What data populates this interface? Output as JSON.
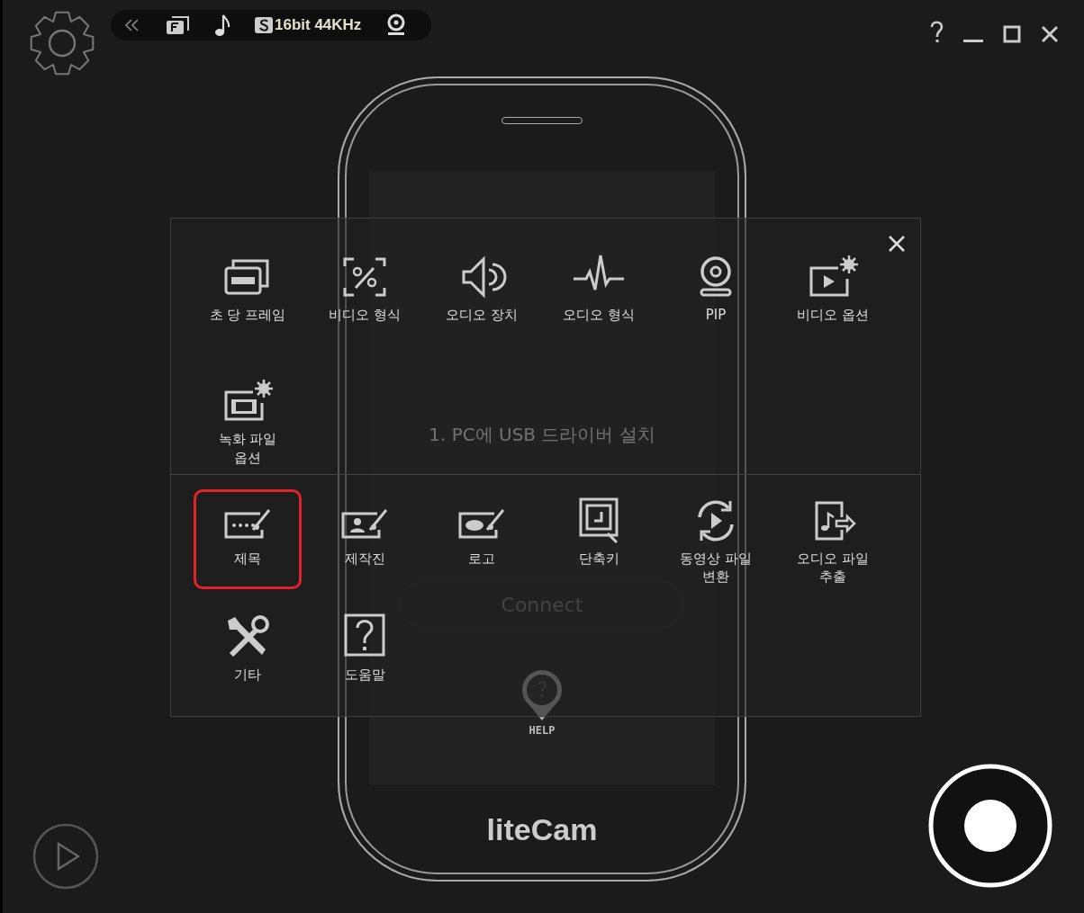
{
  "toolbar": {
    "audio_format": "16bit 44KHz"
  },
  "phone": {
    "step": "1. PC에 USB 드라이버 설치",
    "connect_button": "Connect",
    "help_label": "HELP",
    "logo": "liteCam"
  },
  "menu": {
    "sections": [
      {
        "items": [
          {
            "label": "초 당 프레임",
            "selected": false
          },
          {
            "label": "비디오 형식",
            "selected": false
          },
          {
            "label": "오디오 장치",
            "selected": false
          },
          {
            "label": "오디오 형식",
            "selected": false
          },
          {
            "label": "PIP",
            "selected": false
          },
          {
            "label": "비디오 옵션",
            "selected": false
          },
          {
            "label": "녹화 파일\n옵션",
            "selected": false
          }
        ]
      },
      {
        "items": [
          {
            "label": "제목",
            "selected": true
          },
          {
            "label": "제작진",
            "selected": false
          },
          {
            "label": "로고",
            "selected": false
          },
          {
            "label": "단축키",
            "selected": false
          },
          {
            "label": "동영상 파일\n변환",
            "selected": false
          },
          {
            "label": "오디오 파일\n추출",
            "selected": false
          },
          {
            "label": "기타",
            "selected": false
          },
          {
            "label": "도움말",
            "selected": false
          }
        ]
      }
    ]
  }
}
